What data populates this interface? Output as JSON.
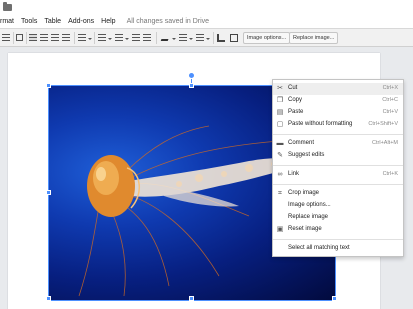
{
  "menu": {
    "items": [
      "rmat",
      "Tools",
      "Table",
      "Add-ons",
      "Help"
    ],
    "status": "All changes saved in Drive"
  },
  "toolbar": {
    "image_options_label": "Image options...",
    "replace_image_label": "Replace image..."
  },
  "context_menu": {
    "items": [
      {
        "label": "Cut",
        "shortcut": "Ctrl+X",
        "icon": "scissors-icon",
        "highlighted": true
      },
      {
        "label": "Copy",
        "shortcut": "Ctrl+C",
        "icon": "copy-icon"
      },
      {
        "label": "Paste",
        "shortcut": "Ctrl+V",
        "icon": "paste-icon"
      },
      {
        "label": "Paste without formatting",
        "shortcut": "Ctrl+Shift+V",
        "icon": "paste-plain-icon"
      },
      {
        "label": "Comment",
        "shortcut": "Ctrl+Alt+M",
        "icon": "comment-icon"
      },
      {
        "label": "Suggest edits",
        "shortcut": "",
        "icon": "suggest-icon"
      },
      {
        "label": "Link",
        "shortcut": "Ctrl+K",
        "icon": "link-icon"
      },
      {
        "label": "Crop image",
        "shortcut": "",
        "icon": "crop-icon"
      },
      {
        "label": "Image options...",
        "shortcut": "",
        "icon": ""
      },
      {
        "label": "Replace image",
        "shortcut": "",
        "icon": ""
      },
      {
        "label": "Reset image",
        "shortcut": "",
        "icon": "reset-image-icon"
      },
      {
        "label": "Select all matching text",
        "shortcut": "",
        "icon": ""
      }
    ]
  },
  "colors": {
    "selection": "#4d90fe",
    "image_background": "#0b2a9e",
    "jellyfish": "#e08a2e"
  }
}
